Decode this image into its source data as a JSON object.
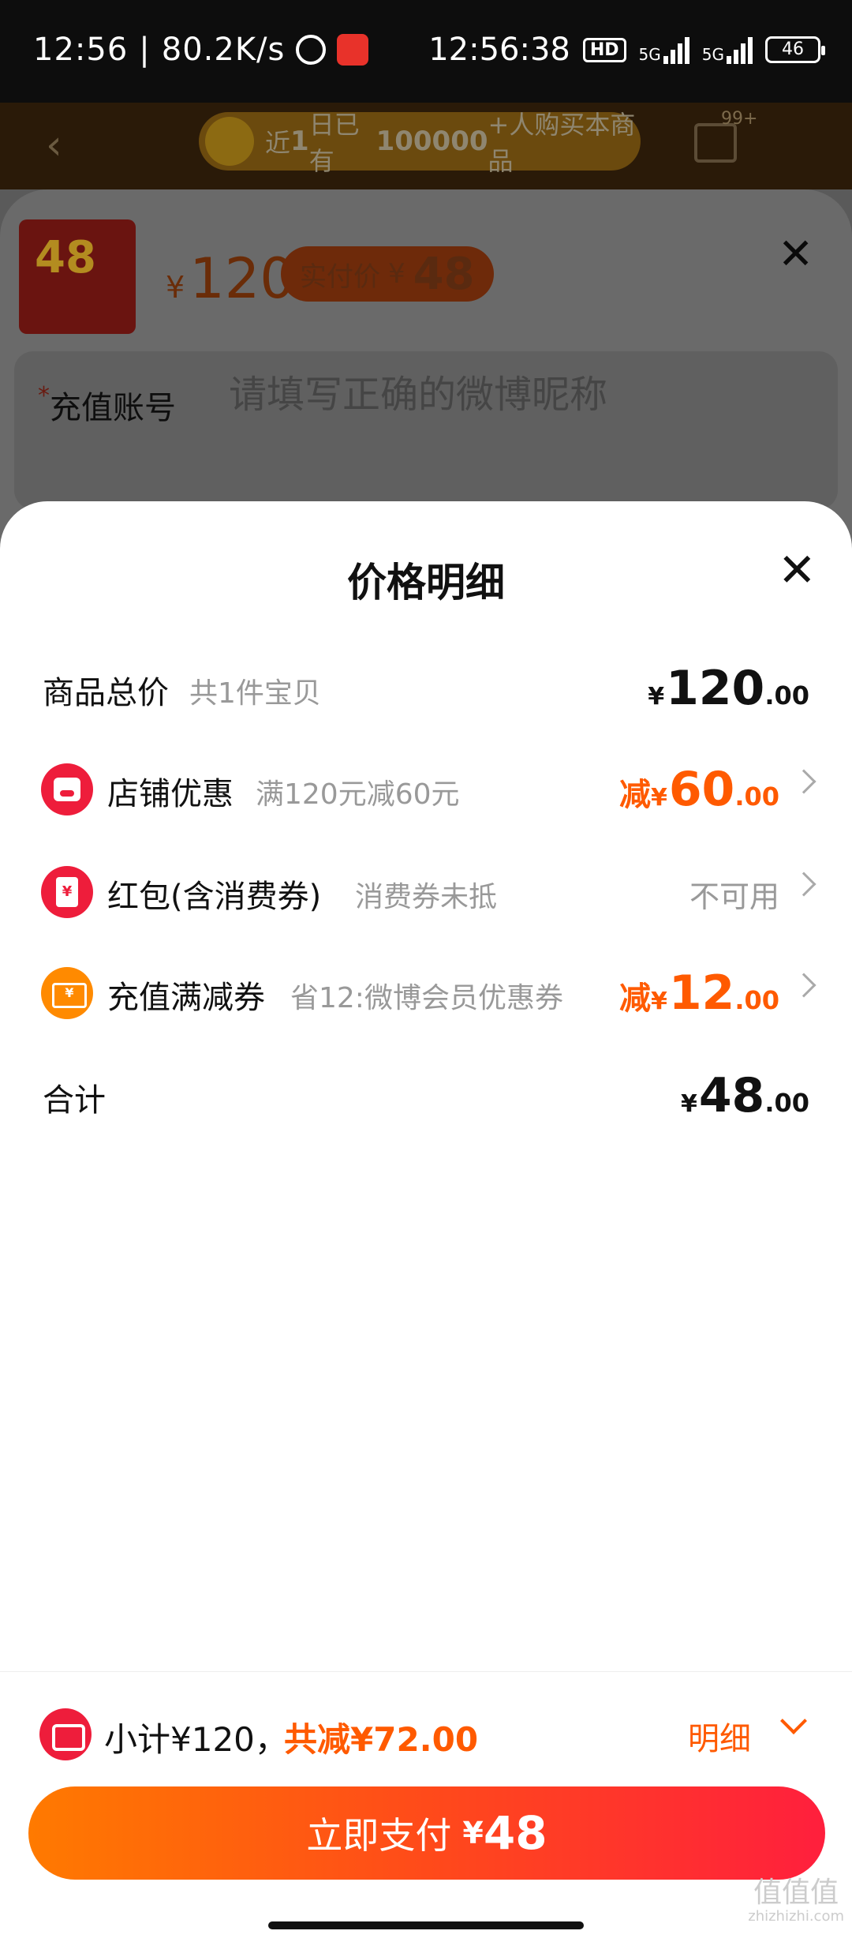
{
  "status_bar": {
    "time_left": "12:56",
    "speed": "80.2K/s",
    "time_right": "12:56:38",
    "hd_label": "HD",
    "network": "5G",
    "battery": "46"
  },
  "page_header": {
    "notice_prefix": "近",
    "notice_days": "1",
    "notice_mid": "日已有",
    "notice_count": "100000",
    "notice_suffix": "+人购买本商品",
    "cart_badge": "99+"
  },
  "order": {
    "thumb_text": "48",
    "price_currency": "¥",
    "price": "120",
    "actual_label": "实付价",
    "actual_currency": "¥",
    "actual_price": "48",
    "account_required_mark": "*",
    "account_label": "充值账号",
    "account_placeholder": "请填写正确的微博昵称"
  },
  "price_detail": {
    "title": "价格明细",
    "rows": [
      {
        "label": "商品总价",
        "sub": "共1件宝贝",
        "prefix": "",
        "currency": "¥",
        "int": "120",
        "dec": ".00"
      },
      {
        "label": "店铺优惠",
        "sub": "满120元减60元",
        "prefix": "减",
        "currency": "¥",
        "int": "60",
        "dec": ".00"
      },
      {
        "label": "红包(含消费券)",
        "sub": "消费券未抵",
        "status": "不可用"
      },
      {
        "label": "充值满减券",
        "sub": "省12:微博会员优惠券",
        "prefix": "减",
        "currency": "¥",
        "int": "12",
        "dec": ".00"
      },
      {
        "label": "合计",
        "currency": "¥",
        "int": "48",
        "dec": ".00"
      }
    ]
  },
  "footer": {
    "subtotal": "小计¥120，",
    "saved": "共减¥72.00",
    "detail_label": "明细",
    "pay_label": "立即支付",
    "pay_currency": "¥",
    "pay_amount": "48"
  },
  "watermark": {
    "text": "值值值",
    "url": "zhizhizhi.com"
  },
  "colors": {
    "accent": "#ff5a00",
    "brand_red": "#ee1d3b",
    "coupon_orange": "#ff8a00"
  }
}
